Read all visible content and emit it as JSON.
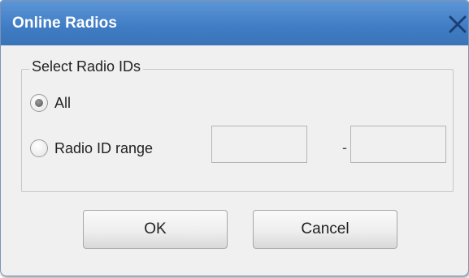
{
  "window": {
    "title": "Online Radios",
    "close_icon": "close-icon",
    "titlebar_color": "#3f7cc4"
  },
  "group": {
    "legend": "Select Radio IDs",
    "options": [
      {
        "label": "All",
        "selected": true
      },
      {
        "label": "Radio ID range",
        "selected": false
      }
    ],
    "range_from": {
      "value": ""
    },
    "range_separator": "-",
    "range_to": {
      "value": ""
    }
  },
  "buttons": {
    "ok_label": "OK",
    "cancel_label": "Cancel"
  }
}
